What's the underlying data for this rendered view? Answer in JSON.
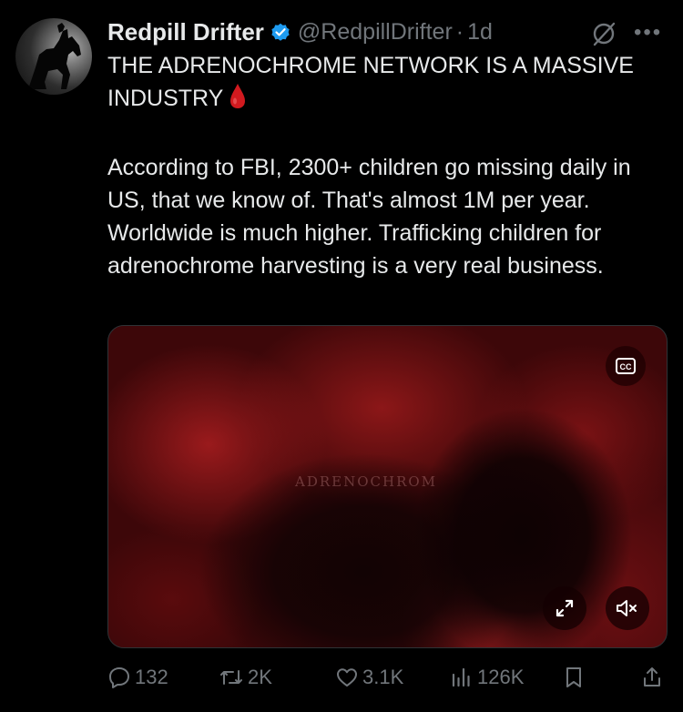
{
  "tweet": {
    "author_name": "Redpill Drifter",
    "handle": "@RedpillDrifter",
    "separator": "·",
    "time": "1d",
    "more_label": "•••",
    "title": "THE ADRENOCHROME NETWORK IS A MASSIVE INDUSTRY",
    "body": "According to FBI, 2300+ children go missing daily in US, that we know of. That's almost 1M per year. Worldwide is much higher. Trafficking children for adrenochrome harvesting is a very real business."
  },
  "media": {
    "watermark": "ADRENOCHROM"
  },
  "actions": {
    "replies": "132",
    "reposts": "2K",
    "likes": "3.1K",
    "views": "126K"
  },
  "colors": {
    "background": "#000000",
    "text": "#e7e9ea",
    "muted": "#71767b",
    "verified": "#1d9bf0",
    "blood_drop": "#d11a1f"
  },
  "icons": [
    "verified-badge-icon",
    "grok-icon",
    "more-icon",
    "blood-drop-emoji",
    "cc-icon",
    "expand-icon",
    "mute-icon",
    "reply-icon",
    "repost-icon",
    "like-icon",
    "views-icon",
    "bookmark-icon",
    "share-icon"
  ]
}
